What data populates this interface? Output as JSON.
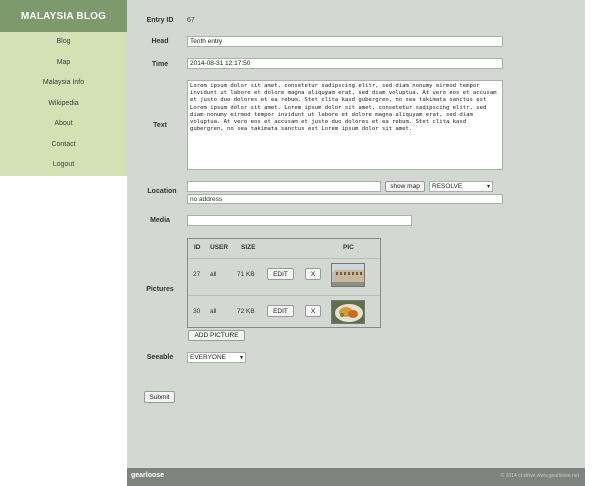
{
  "sidebar": {
    "brand": "MALAYSIA BLOG",
    "items": [
      {
        "label": "Blog"
      },
      {
        "label": "Map"
      },
      {
        "label": "Malaysia Info"
      },
      {
        "label": "Wikipedia"
      },
      {
        "label": "About"
      },
      {
        "label": "Contact"
      },
      {
        "label": "Logout"
      }
    ]
  },
  "form": {
    "entry_id_label": "Entry ID",
    "entry_id_value": "67",
    "head_label": "Head",
    "head_value": "Tenth entry",
    "time_label": "Time",
    "time_value": "2014-08-31 12:17:50",
    "text_label": "Text",
    "text_value": "Lorem ipsum dolor sit amet, consetetur sadipscing elitr, sed diam nonumy eirmod tempor invidunt ut labore et dolore magna aliquyam erat, sed diam voluptua. At vero eos et accusam et justo duo dolores et ea rebum. Stet clita kasd gubergren, no sea takimata sanctus est Lorem ipsum dolor sit amet. Lorem ipsum dolor sit amet, consetetur sadipscing elitr, sed diam nonumy eirmod tempor invidunt ut labore et dolore magna aliquyam erat, sed diam voluptua. At vero eos et accusam et justo duo dolores et ea rebum. Stet clita kasd gubergren, no sea takimata sanctus est Lorem ipsum dolor sit amet.",
    "location_label": "Location",
    "location_value": "",
    "show_map_label": "show map",
    "resolve_selected": "RESOLVE",
    "address_value": "no address",
    "media_label": "Media",
    "media_value": "",
    "pictures_label": "Pictures",
    "pictures_headers": {
      "id": "ID",
      "user": "USER",
      "size": "SIZE",
      "pic": "PIC"
    },
    "pictures": [
      {
        "id": "27",
        "user": "all",
        "size": "71 KB",
        "edit": "EDIT",
        "delete": "X"
      },
      {
        "id": "30",
        "user": "all",
        "size": "72 KB",
        "edit": "EDIT",
        "delete": "X"
      }
    ],
    "add_picture_label": "ADD PICTURE",
    "seeable_label": "Seeable",
    "seeable_selected": "EVERYONE",
    "submit_label": "Submit"
  },
  "footer": {
    "logo": "gearloose",
    "copyright": "© 2014 ct strive  www.gearloose.net"
  },
  "colors": {
    "sidebar_bg": "#d3e2b4",
    "brand_bg": "#7c9a6c",
    "main_bg": "#d3d8d3",
    "footer_bg": "#7f837f"
  }
}
